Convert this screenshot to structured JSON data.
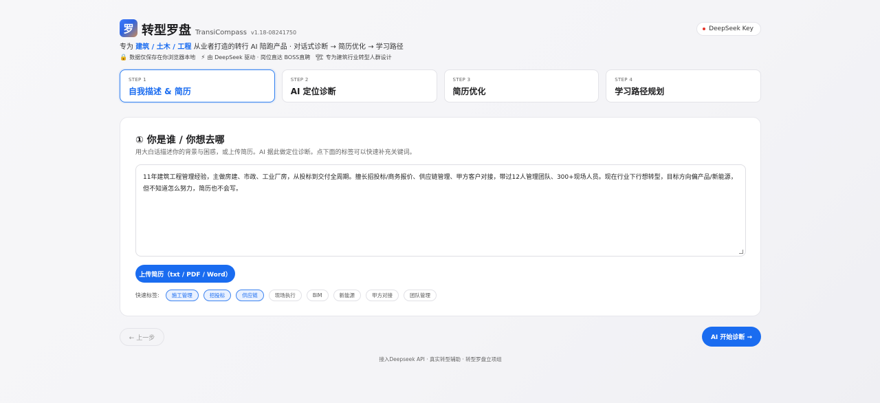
{
  "header": {
    "logo_char": "罗",
    "brand_name": "转型罗盘",
    "brand_en": "TransiCompass",
    "version": "v1.18-08241750",
    "tagline_prefix": "专为",
    "tagline_highlight": "建筑 / 土木 / 工程",
    "tagline_suffix": "从业者打造的转行 AI 陪跑产品 · 对话式诊断 → 简历优化 → 学习路径",
    "features": [
      {
        "icon": "lock-icon",
        "glyph": "🔒",
        "text": "数据仅保存在你浏览器本地"
      },
      {
        "icon": "lightning-icon",
        "glyph": "⚡",
        "text": "由 DeepSeek 驱动 · 岗位直达 BOSS直聘"
      },
      {
        "icon": "construction-icon",
        "glyph": "🏗",
        "text": "专为建筑行业转型人群设计"
      }
    ],
    "key_button": "DeepSeek Key"
  },
  "steps": [
    {
      "num": "STEP 1",
      "title": "自我描述 & 简历",
      "active": true
    },
    {
      "num": "STEP 2",
      "title": "AI 定位诊断",
      "active": false
    },
    {
      "num": "STEP 3",
      "title": "简历优化",
      "active": false
    },
    {
      "num": "STEP 4",
      "title": "学习路径规划",
      "active": false
    }
  ],
  "card": {
    "title": "① 你是谁 / 你想去哪",
    "description": "用大白话描述你的背景与困惑，或上传简历。AI 据此做定位诊断。点下面的标签可以快速补充关键词。",
    "textarea_value": "11年建筑工程管理经验，主做房建、市政、工业厂房，从投标到交付全周期。擅长招投标/商务报价、供应链管理、甲方客户对接，带过12人管理团队、300+现场人员。现在行业下行想转型，目标方向偏产品/新能源，但不知道怎么努力，简历也不会写。",
    "upload_label": "上传简历（txt / PDF / Word）",
    "tags_label": "快速标签:",
    "tags": [
      {
        "label": "施工管理",
        "selected": true
      },
      {
        "label": "招投标",
        "selected": true
      },
      {
        "label": "供应链",
        "selected": true
      },
      {
        "label": "现场执行",
        "selected": false
      },
      {
        "label": "BIM",
        "selected": false
      },
      {
        "label": "新能源",
        "selected": false
      },
      {
        "label": "甲方对接",
        "selected": false
      },
      {
        "label": "团队管理",
        "selected": false
      }
    ]
  },
  "nav": {
    "prev_label": "← 上一步",
    "next_label": "AI 开始诊断 →"
  },
  "footer": "接入Deepseek API · 真实转型辅助 · 转型罗盘立项组",
  "colors": {
    "accent": "#1a6cf0",
    "key_dot": "#e5342a"
  }
}
